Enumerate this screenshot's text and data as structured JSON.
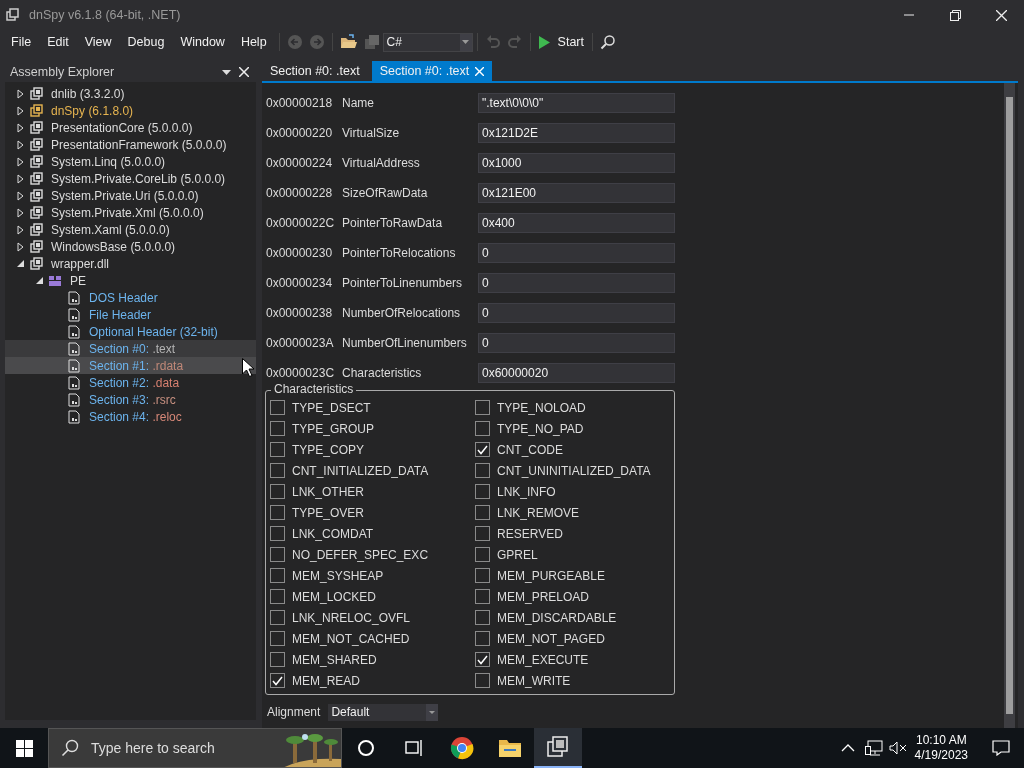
{
  "window": {
    "title": "dnSpy v6.1.8 (64-bit, .NET)"
  },
  "menu": [
    "File",
    "Edit",
    "View",
    "Debug",
    "Window",
    "Help"
  ],
  "toolbar": {
    "language": "C#",
    "start": "Start"
  },
  "explorer": {
    "title": "Assembly Explorer",
    "tree": [
      {
        "name": "dnlib",
        "detail": "(3.3.2.0)",
        "color": "#dcdcdc",
        "expanded": false,
        "selected": false
      },
      {
        "name": "dnSpy",
        "detail": "(6.1.8.0)",
        "color": "#e6b450",
        "expanded": false,
        "selected": false
      },
      {
        "name": "PresentationCore",
        "detail": "(5.0.0.0)",
        "color": "#dcdcdc",
        "expanded": false,
        "selected": false
      },
      {
        "name": "PresentationFramework",
        "detail": "(5.0.0.0)",
        "color": "#dcdcdc",
        "expanded": false,
        "selected": false
      },
      {
        "name": "System.Linq",
        "detail": "(5.0.0.0)",
        "color": "#dcdcdc",
        "expanded": false,
        "selected": false
      },
      {
        "name": "System.Private.CoreLib",
        "detail": "(5.0.0.0)",
        "color": "#dcdcdc",
        "expanded": false,
        "selected": false
      },
      {
        "name": "System.Private.Uri",
        "detail": "(5.0.0.0)",
        "color": "#dcdcdc",
        "expanded": false,
        "selected": false
      },
      {
        "name": "System.Private.Xml",
        "detail": "(5.0.0.0)",
        "color": "#dcdcdc",
        "expanded": false,
        "selected": false
      },
      {
        "name": "System.Xaml",
        "detail": "(5.0.0.0)",
        "color": "#dcdcdc",
        "expanded": false,
        "selected": false
      },
      {
        "name": "WindowsBase",
        "detail": "(5.0.0.0)",
        "color": "#dcdcdc",
        "expanded": false,
        "selected": false
      },
      {
        "name": "wrapper.dll",
        "color": "#dcdcdc",
        "expanded": true,
        "selected": false,
        "children": [
          {
            "name": "PE",
            "color": "#dcdcdc",
            "expanded": true,
            "selected": false,
            "children": [
              {
                "name": "DOS Header",
                "color": "#6cb4ee",
                "selected": false
              },
              {
                "name": "File Header",
                "color": "#6cb4ee",
                "selected": false
              },
              {
                "name": "Optional Header (32-bit)",
                "color": "#6cb4ee",
                "selected": false
              },
              {
                "name": "Section #0:",
                "detail": {
                  "text": ".text",
                  "color": "#b4b4b4"
                },
                "color": "#6cb4ee",
                "selected": true
              },
              {
                "name": "Section #1:",
                "detail": {
                  "text": ".rdata",
                  "color": "#c08878"
                },
                "color": "#6cb4ee",
                "selected": false,
                "hovered": true
              },
              {
                "name": "Section #2:",
                "detail": {
                  "text": ".data",
                  "color": "#d88070"
                },
                "color": "#6cb4ee",
                "selected": false
              },
              {
                "name": "Section #3:",
                "detail": {
                  "text": ".rsrc",
                  "color": "#c89080"
                },
                "color": "#6cb4ee",
                "selected": false
              },
              {
                "name": "Section #4:",
                "detail": {
                  "text": ".reloc",
                  "color": "#d88878"
                },
                "color": "#6cb4ee",
                "selected": false
              }
            ]
          }
        ]
      }
    ]
  },
  "tabs": [
    {
      "label": "Section #0: .text",
      "selected": false
    },
    {
      "label": "Section #0: .text",
      "selected": true
    }
  ],
  "fields": [
    {
      "offset": "0x00000218",
      "name": "Name",
      "value": "\".text\\0\\0\\0\""
    },
    {
      "offset": "0x00000220",
      "name": "VirtualSize",
      "value": "0x121D2E"
    },
    {
      "offset": "0x00000224",
      "name": "VirtualAddress",
      "value": "0x1000"
    },
    {
      "offset": "0x00000228",
      "name": "SizeOfRawData",
      "value": "0x121E00"
    },
    {
      "offset": "0x0000022C",
      "name": "PointerToRawData",
      "value": "0x400"
    },
    {
      "offset": "0x00000230",
      "name": "PointerToRelocations",
      "value": "0"
    },
    {
      "offset": "0x00000234",
      "name": "PointerToLinenumbers",
      "value": "0"
    },
    {
      "offset": "0x00000238",
      "name": "NumberOfRelocations",
      "value": "0"
    },
    {
      "offset": "0x0000023A",
      "name": "NumberOfLinenumbers",
      "value": "0"
    },
    {
      "offset": "0x0000023C",
      "name": "Characteristics",
      "value": "0x60000020"
    }
  ],
  "characteristics": {
    "title": "Characteristics",
    "flags": [
      {
        "label": "TYPE_DSECT",
        "checked": false
      },
      {
        "label": "TYPE_NOLOAD",
        "checked": false
      },
      {
        "label": "TYPE_GROUP",
        "checked": false
      },
      {
        "label": "TYPE_NO_PAD",
        "checked": false
      },
      {
        "label": "TYPE_COPY",
        "checked": false
      },
      {
        "label": "CNT_CODE",
        "checked": true
      },
      {
        "label": "CNT_INITIALIZED_DATA",
        "checked": false
      },
      {
        "label": "CNT_UNINITIALIZED_DATA",
        "checked": false
      },
      {
        "label": "LNK_OTHER",
        "checked": false
      },
      {
        "label": "LNK_INFO",
        "checked": false
      },
      {
        "label": "TYPE_OVER",
        "checked": false
      },
      {
        "label": "LNK_REMOVE",
        "checked": false
      },
      {
        "label": "LNK_COMDAT",
        "checked": false
      },
      {
        "label": "RESERVED",
        "checked": false
      },
      {
        "label": "NO_DEFER_SPEC_EXC",
        "checked": false
      },
      {
        "label": "GPREL",
        "checked": false
      },
      {
        "label": "MEM_SYSHEAP",
        "checked": false
      },
      {
        "label": "MEM_PURGEABLE",
        "checked": false
      },
      {
        "label": "MEM_LOCKED",
        "checked": false
      },
      {
        "label": "MEM_PRELOAD",
        "checked": false
      },
      {
        "label": "LNK_NRELOC_OVFL",
        "checked": false
      },
      {
        "label": "MEM_DISCARDABLE",
        "checked": false
      },
      {
        "label": "MEM_NOT_CACHED",
        "checked": false
      },
      {
        "label": "MEM_NOT_PAGED",
        "checked": false
      },
      {
        "label": "MEM_SHARED",
        "checked": false
      },
      {
        "label": "MEM_EXECUTE",
        "checked": true
      },
      {
        "label": "MEM_READ",
        "checked": true
      },
      {
        "label": "MEM_WRITE",
        "checked": false
      }
    ]
  },
  "alignment": {
    "label": "Alignment",
    "value": "Default"
  },
  "taskbar": {
    "search_placeholder": "Type here to search",
    "time": "10:10 AM",
    "date": "4/19/2023"
  }
}
